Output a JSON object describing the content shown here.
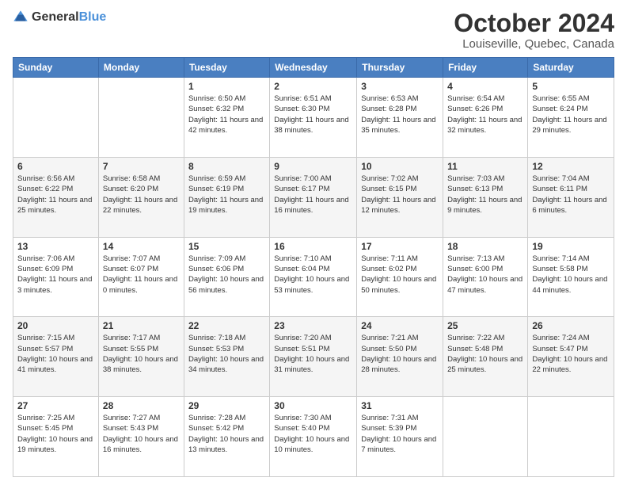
{
  "logo": {
    "general": "General",
    "blue": "Blue"
  },
  "header": {
    "month": "October 2024",
    "location": "Louiseville, Quebec, Canada"
  },
  "weekdays": [
    "Sunday",
    "Monday",
    "Tuesday",
    "Wednesday",
    "Thursday",
    "Friday",
    "Saturday"
  ],
  "weeks": [
    [
      {
        "day": "",
        "sunrise": "",
        "sunset": "",
        "daylight": ""
      },
      {
        "day": "",
        "sunrise": "",
        "sunset": "",
        "daylight": ""
      },
      {
        "day": "1",
        "sunrise": "Sunrise: 6:50 AM",
        "sunset": "Sunset: 6:32 PM",
        "daylight": "Daylight: 11 hours and 42 minutes."
      },
      {
        "day": "2",
        "sunrise": "Sunrise: 6:51 AM",
        "sunset": "Sunset: 6:30 PM",
        "daylight": "Daylight: 11 hours and 38 minutes."
      },
      {
        "day": "3",
        "sunrise": "Sunrise: 6:53 AM",
        "sunset": "Sunset: 6:28 PM",
        "daylight": "Daylight: 11 hours and 35 minutes."
      },
      {
        "day": "4",
        "sunrise": "Sunrise: 6:54 AM",
        "sunset": "Sunset: 6:26 PM",
        "daylight": "Daylight: 11 hours and 32 minutes."
      },
      {
        "day": "5",
        "sunrise": "Sunrise: 6:55 AM",
        "sunset": "Sunset: 6:24 PM",
        "daylight": "Daylight: 11 hours and 29 minutes."
      }
    ],
    [
      {
        "day": "6",
        "sunrise": "Sunrise: 6:56 AM",
        "sunset": "Sunset: 6:22 PM",
        "daylight": "Daylight: 11 hours and 25 minutes."
      },
      {
        "day": "7",
        "sunrise": "Sunrise: 6:58 AM",
        "sunset": "Sunset: 6:20 PM",
        "daylight": "Daylight: 11 hours and 22 minutes."
      },
      {
        "day": "8",
        "sunrise": "Sunrise: 6:59 AM",
        "sunset": "Sunset: 6:19 PM",
        "daylight": "Daylight: 11 hours and 19 minutes."
      },
      {
        "day": "9",
        "sunrise": "Sunrise: 7:00 AM",
        "sunset": "Sunset: 6:17 PM",
        "daylight": "Daylight: 11 hours and 16 minutes."
      },
      {
        "day": "10",
        "sunrise": "Sunrise: 7:02 AM",
        "sunset": "Sunset: 6:15 PM",
        "daylight": "Daylight: 11 hours and 12 minutes."
      },
      {
        "day": "11",
        "sunrise": "Sunrise: 7:03 AM",
        "sunset": "Sunset: 6:13 PM",
        "daylight": "Daylight: 11 hours and 9 minutes."
      },
      {
        "day": "12",
        "sunrise": "Sunrise: 7:04 AM",
        "sunset": "Sunset: 6:11 PM",
        "daylight": "Daylight: 11 hours and 6 minutes."
      }
    ],
    [
      {
        "day": "13",
        "sunrise": "Sunrise: 7:06 AM",
        "sunset": "Sunset: 6:09 PM",
        "daylight": "Daylight: 11 hours and 3 minutes."
      },
      {
        "day": "14",
        "sunrise": "Sunrise: 7:07 AM",
        "sunset": "Sunset: 6:07 PM",
        "daylight": "Daylight: 11 hours and 0 minutes."
      },
      {
        "day": "15",
        "sunrise": "Sunrise: 7:09 AM",
        "sunset": "Sunset: 6:06 PM",
        "daylight": "Daylight: 10 hours and 56 minutes."
      },
      {
        "day": "16",
        "sunrise": "Sunrise: 7:10 AM",
        "sunset": "Sunset: 6:04 PM",
        "daylight": "Daylight: 10 hours and 53 minutes."
      },
      {
        "day": "17",
        "sunrise": "Sunrise: 7:11 AM",
        "sunset": "Sunset: 6:02 PM",
        "daylight": "Daylight: 10 hours and 50 minutes."
      },
      {
        "day": "18",
        "sunrise": "Sunrise: 7:13 AM",
        "sunset": "Sunset: 6:00 PM",
        "daylight": "Daylight: 10 hours and 47 minutes."
      },
      {
        "day": "19",
        "sunrise": "Sunrise: 7:14 AM",
        "sunset": "Sunset: 5:58 PM",
        "daylight": "Daylight: 10 hours and 44 minutes."
      }
    ],
    [
      {
        "day": "20",
        "sunrise": "Sunrise: 7:15 AM",
        "sunset": "Sunset: 5:57 PM",
        "daylight": "Daylight: 10 hours and 41 minutes."
      },
      {
        "day": "21",
        "sunrise": "Sunrise: 7:17 AM",
        "sunset": "Sunset: 5:55 PM",
        "daylight": "Daylight: 10 hours and 38 minutes."
      },
      {
        "day": "22",
        "sunrise": "Sunrise: 7:18 AM",
        "sunset": "Sunset: 5:53 PM",
        "daylight": "Daylight: 10 hours and 34 minutes."
      },
      {
        "day": "23",
        "sunrise": "Sunrise: 7:20 AM",
        "sunset": "Sunset: 5:51 PM",
        "daylight": "Daylight: 10 hours and 31 minutes."
      },
      {
        "day": "24",
        "sunrise": "Sunrise: 7:21 AM",
        "sunset": "Sunset: 5:50 PM",
        "daylight": "Daylight: 10 hours and 28 minutes."
      },
      {
        "day": "25",
        "sunrise": "Sunrise: 7:22 AM",
        "sunset": "Sunset: 5:48 PM",
        "daylight": "Daylight: 10 hours and 25 minutes."
      },
      {
        "day": "26",
        "sunrise": "Sunrise: 7:24 AM",
        "sunset": "Sunset: 5:47 PM",
        "daylight": "Daylight: 10 hours and 22 minutes."
      }
    ],
    [
      {
        "day": "27",
        "sunrise": "Sunrise: 7:25 AM",
        "sunset": "Sunset: 5:45 PM",
        "daylight": "Daylight: 10 hours and 19 minutes."
      },
      {
        "day": "28",
        "sunrise": "Sunrise: 7:27 AM",
        "sunset": "Sunset: 5:43 PM",
        "daylight": "Daylight: 10 hours and 16 minutes."
      },
      {
        "day": "29",
        "sunrise": "Sunrise: 7:28 AM",
        "sunset": "Sunset: 5:42 PM",
        "daylight": "Daylight: 10 hours and 13 minutes."
      },
      {
        "day": "30",
        "sunrise": "Sunrise: 7:30 AM",
        "sunset": "Sunset: 5:40 PM",
        "daylight": "Daylight: 10 hours and 10 minutes."
      },
      {
        "day": "31",
        "sunrise": "Sunrise: 7:31 AM",
        "sunset": "Sunset: 5:39 PM",
        "daylight": "Daylight: 10 hours and 7 minutes."
      },
      {
        "day": "",
        "sunrise": "",
        "sunset": "",
        "daylight": ""
      },
      {
        "day": "",
        "sunrise": "",
        "sunset": "",
        "daylight": ""
      }
    ]
  ]
}
